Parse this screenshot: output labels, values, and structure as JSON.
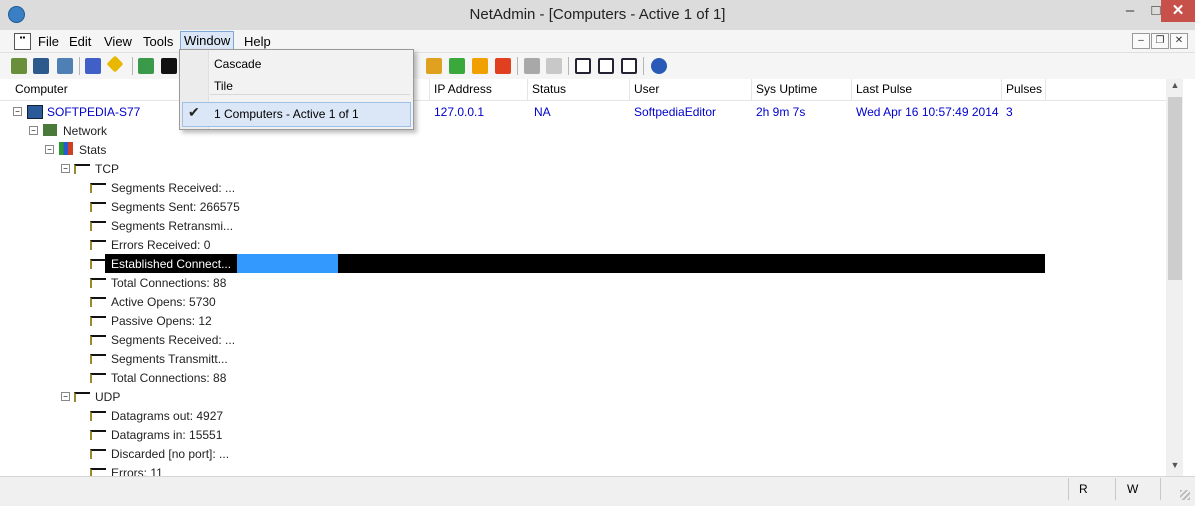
{
  "window": {
    "title": "NetAdmin - [Computers - Active 1 of 1]",
    "min_glyph": "–",
    "max_glyph": "□",
    "close_glyph": "✕"
  },
  "menubar": {
    "items": [
      "File",
      "Edit",
      "View",
      "Tools",
      "Window",
      "Help"
    ],
    "mdi_min": "–",
    "mdi_restore": "❐",
    "mdi_close": "✕"
  },
  "window_menu": {
    "items": [
      "Cascade",
      "Tile"
    ],
    "checked_item": "1 Computers - Active 1 of 1",
    "check_glyph": "✔"
  },
  "columns": [
    "Computer",
    "IP Address",
    "Status",
    "User",
    "Sys Uptime",
    "Last Pulse",
    "Pulses"
  ],
  "computer_row": {
    "name": "SOFTPEDIA-S77",
    "ip": "127.0.0.1",
    "status": "NA",
    "user": "SoftpediaEditor",
    "uptime": "2h 9m 7s",
    "last_pulse": "Wed Apr 16 10:57:49 2014",
    "pulses": "3"
  },
  "tree": {
    "network": "Network",
    "stats": "Stats",
    "tcp": "TCP",
    "udp": "UDP",
    "tcp_items": [
      "Segments Received: ...",
      "Segments Sent: 266575",
      "Segments Retransmi...",
      "Errors Received: 0",
      "Established Connect...",
      "Total Connections: 88",
      "Active Opens: 5730",
      "Passive Opens: 12",
      "Segments Received: ...",
      "Segments Transmitt...",
      "Total Connections: 88"
    ],
    "udp_items": [
      "Datagrams out: 4927",
      "Datagrams in: 15551",
      "Discarded [no port]: ...",
      "Errors: 11"
    ],
    "collapse_glyph": "−"
  },
  "statusbar": {
    "r": "R",
    "w": "W"
  },
  "colors": {
    "link": "#0000cc",
    "selection": "#000000",
    "selection_accent": "#3399ff",
    "close_button": "#c7504a"
  }
}
